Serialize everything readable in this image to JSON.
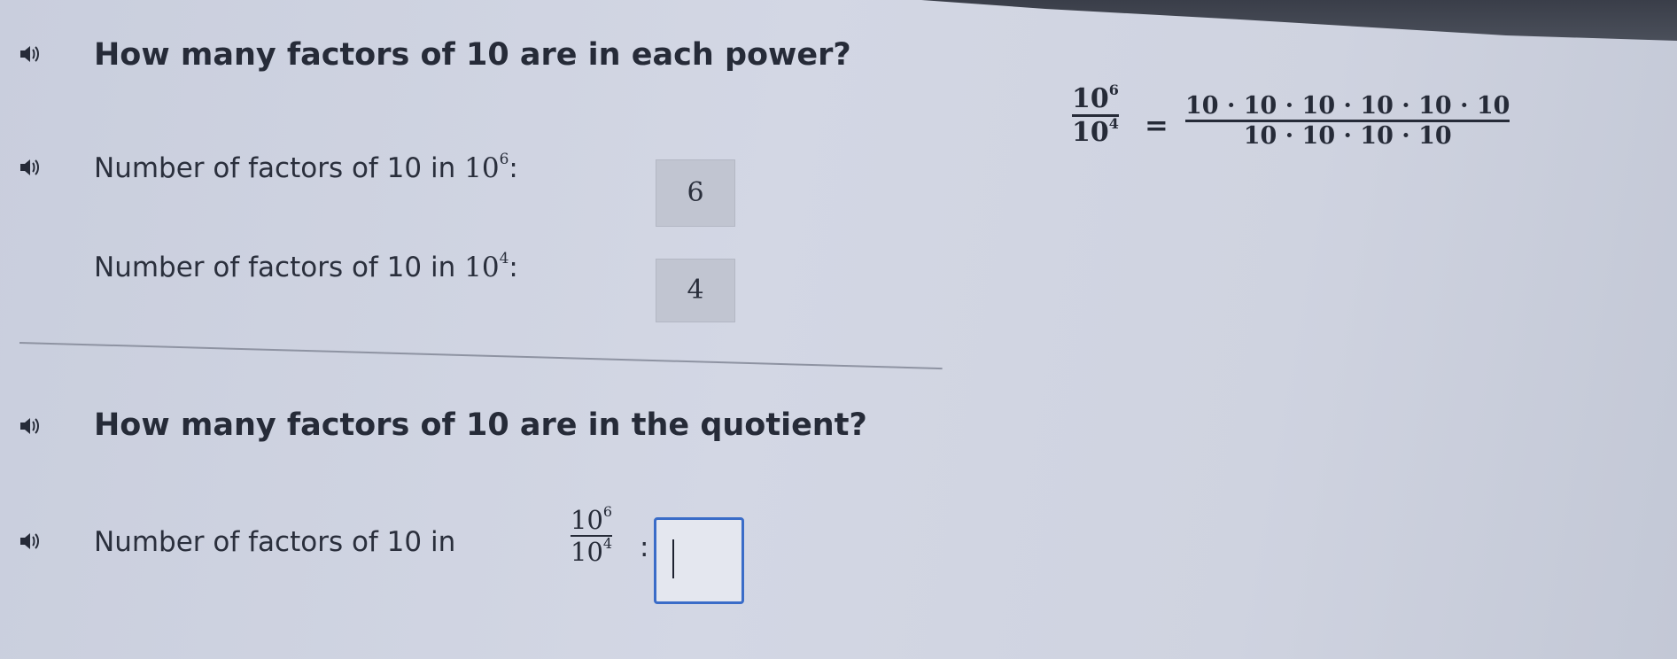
{
  "section1": {
    "question": "How many factors of 10 are in each power?",
    "row1": {
      "label": "Number of factors of 10 in",
      "base": "10",
      "exponent": "6",
      "colon": ":",
      "answer": "6"
    },
    "row2": {
      "label": "Number of factors of 10 in",
      "base": "10",
      "exponent": "4",
      "colon": ":",
      "answer": "4"
    }
  },
  "equation": {
    "lhs_num_base": "10",
    "lhs_num_exp": "6",
    "lhs_den_base": "10",
    "lhs_den_exp": "4",
    "equals": "=",
    "rhs_num": "10 · 10 · 10 · 10 · 10 · 10",
    "rhs_den": "10 · 10 · 10 · 10"
  },
  "section2": {
    "question": "How many factors of 10 are in the quotient?",
    "row": {
      "label": "Number of factors of 10 in",
      "num_base": "10",
      "num_exp": "6",
      "den_base": "10",
      "den_exp": "4",
      "colon": ":",
      "answer": ""
    }
  },
  "icons": {
    "audio": "speaker-icon"
  },
  "colors": {
    "input_border": "#3a6cc8",
    "answer_box": "#c1c5d1"
  }
}
